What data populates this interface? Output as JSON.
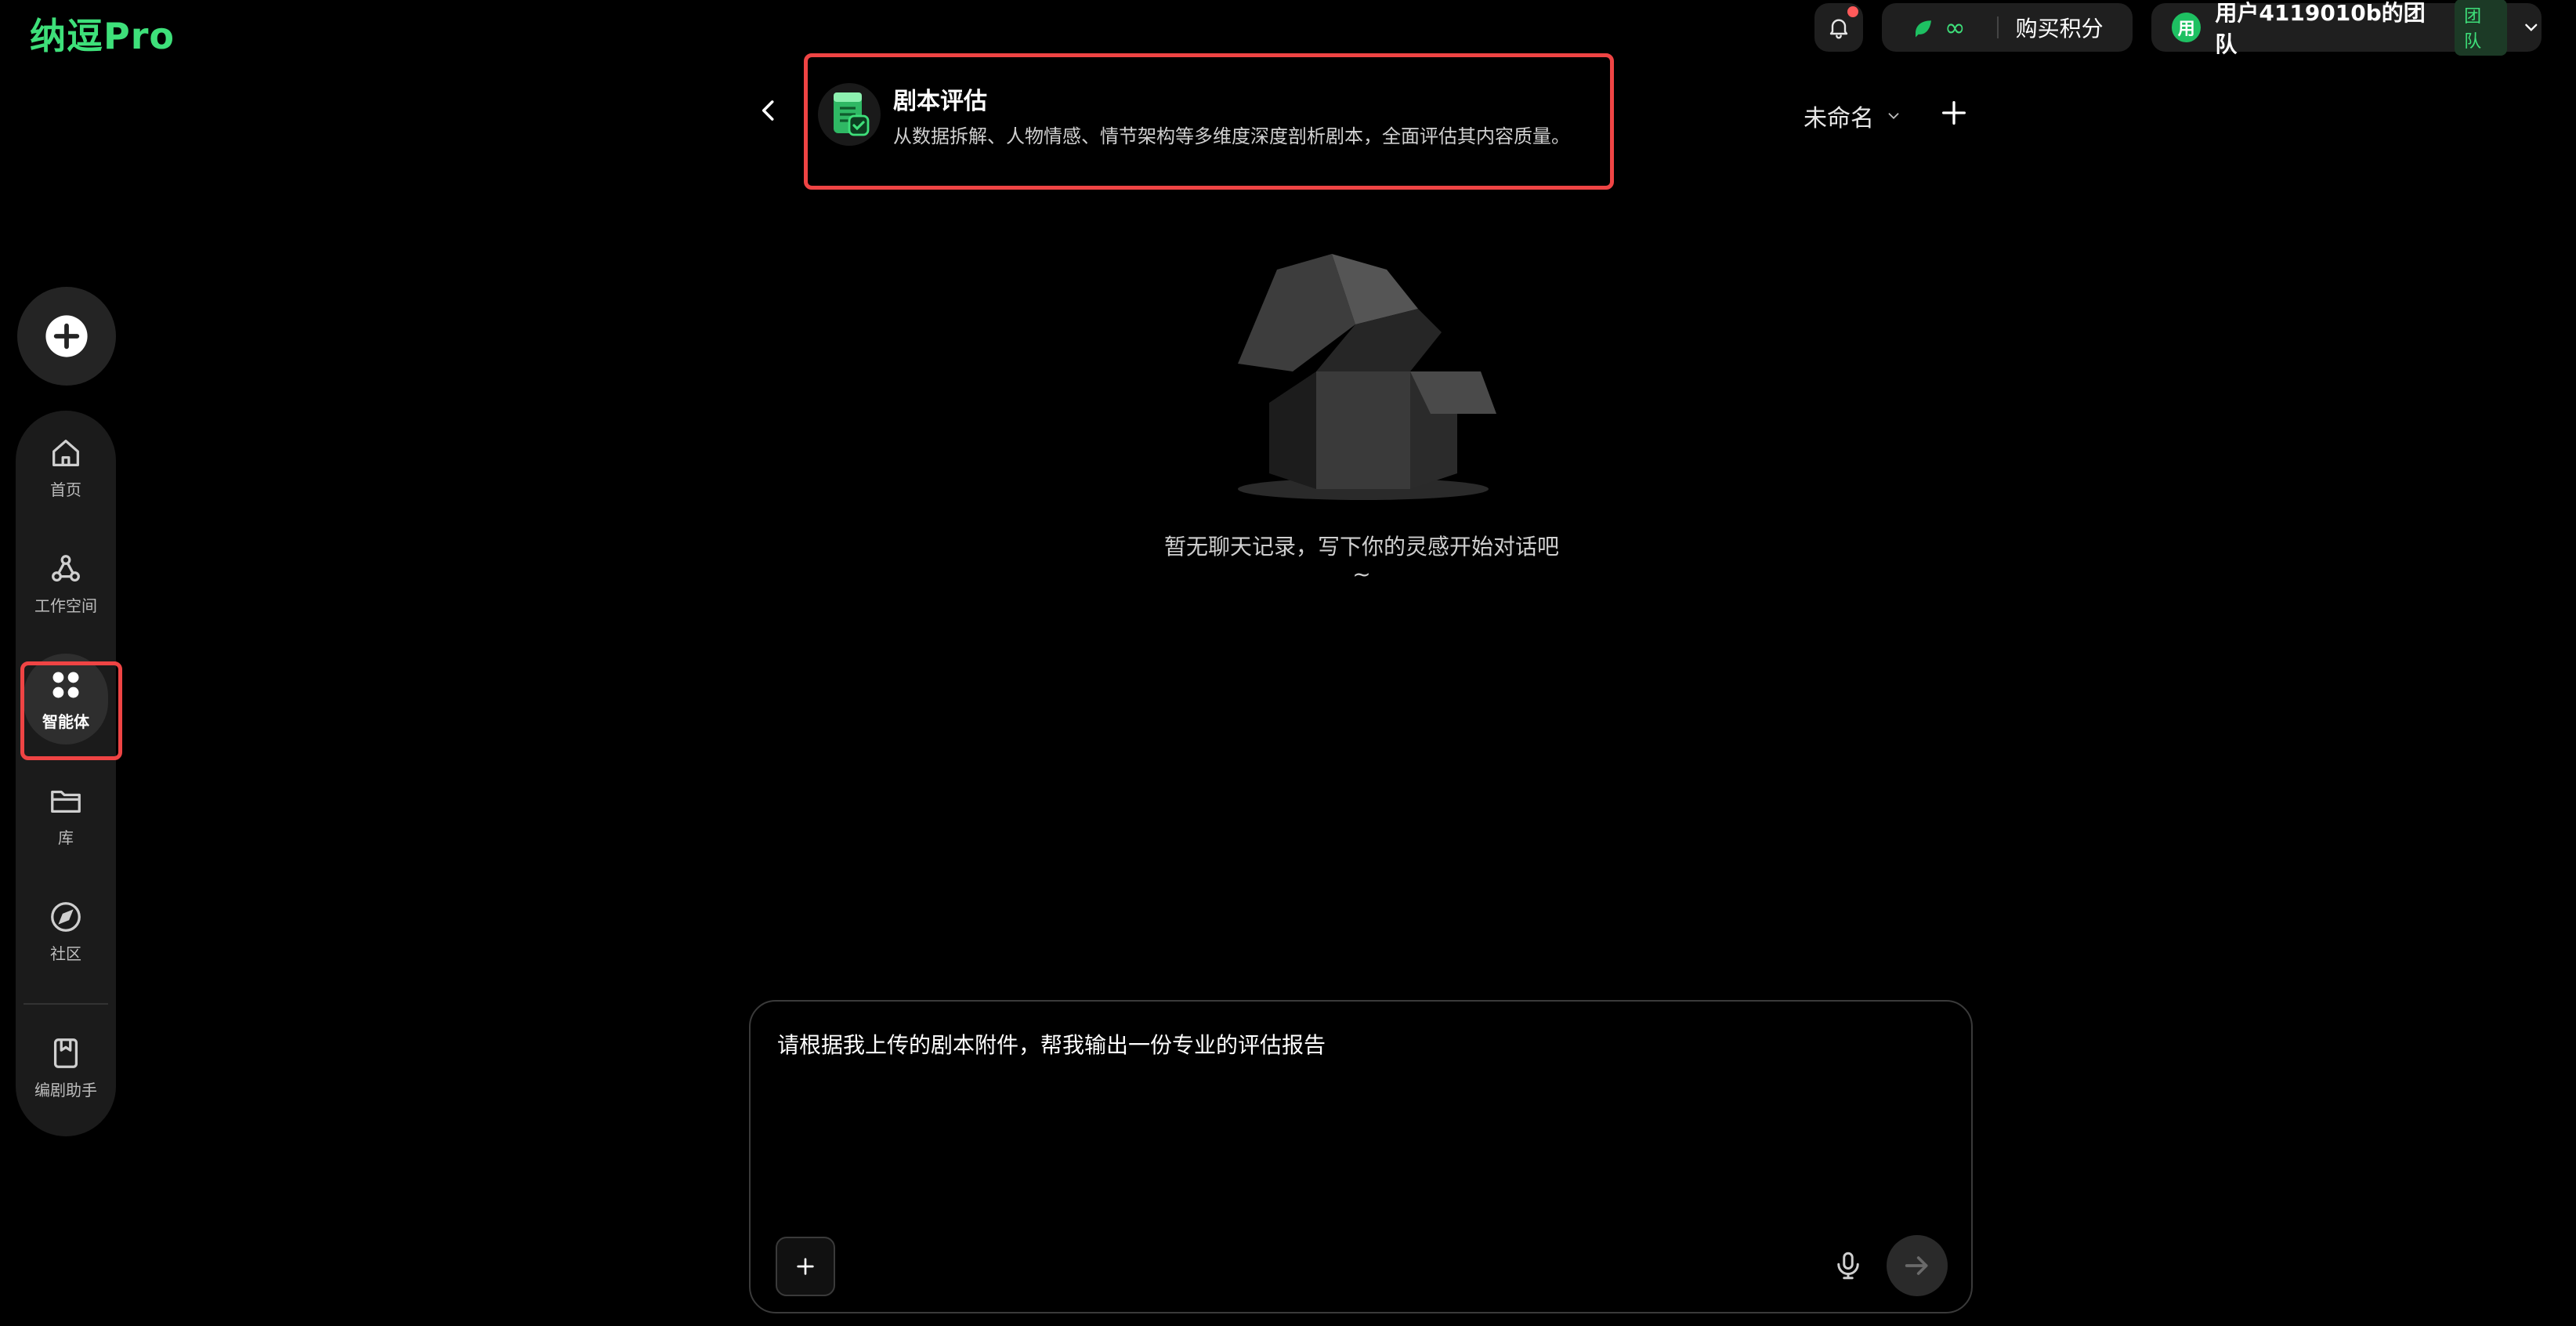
{
  "brand": {
    "name": "纳逗Pro"
  },
  "header": {
    "credits": {
      "amount": "∞",
      "buy_label": "购买积分"
    },
    "team": {
      "avatar_text": "用",
      "name": "用户4119010b的团队",
      "badge": "团队"
    }
  },
  "sidebar": {
    "items": [
      {
        "label": "首页",
        "icon": "home-icon"
      },
      {
        "label": "工作空间",
        "icon": "workspace-icon"
      },
      {
        "label": "智能体",
        "icon": "agents-icon",
        "active": true
      },
      {
        "label": "库",
        "icon": "folder-icon"
      },
      {
        "label": "社区",
        "icon": "compass-icon"
      },
      {
        "label": "编剧助手",
        "icon": "bookmark-icon"
      }
    ]
  },
  "agent": {
    "title": "剧本评估",
    "description": "从数据拆解、人物情感、情节架构等多维度深度剖析剧本，全面评估其内容质量。"
  },
  "session": {
    "name": "未命名"
  },
  "empty_state": {
    "message": "暂无聊天记录，写下你的灵感开始对话吧~"
  },
  "composer": {
    "text": "请根据我上传的剧本附件，帮我输出一份专业的评估报告"
  },
  "colors": {
    "accent": "#3ee07a",
    "highlight": "#ef4444",
    "background": "#000000"
  }
}
